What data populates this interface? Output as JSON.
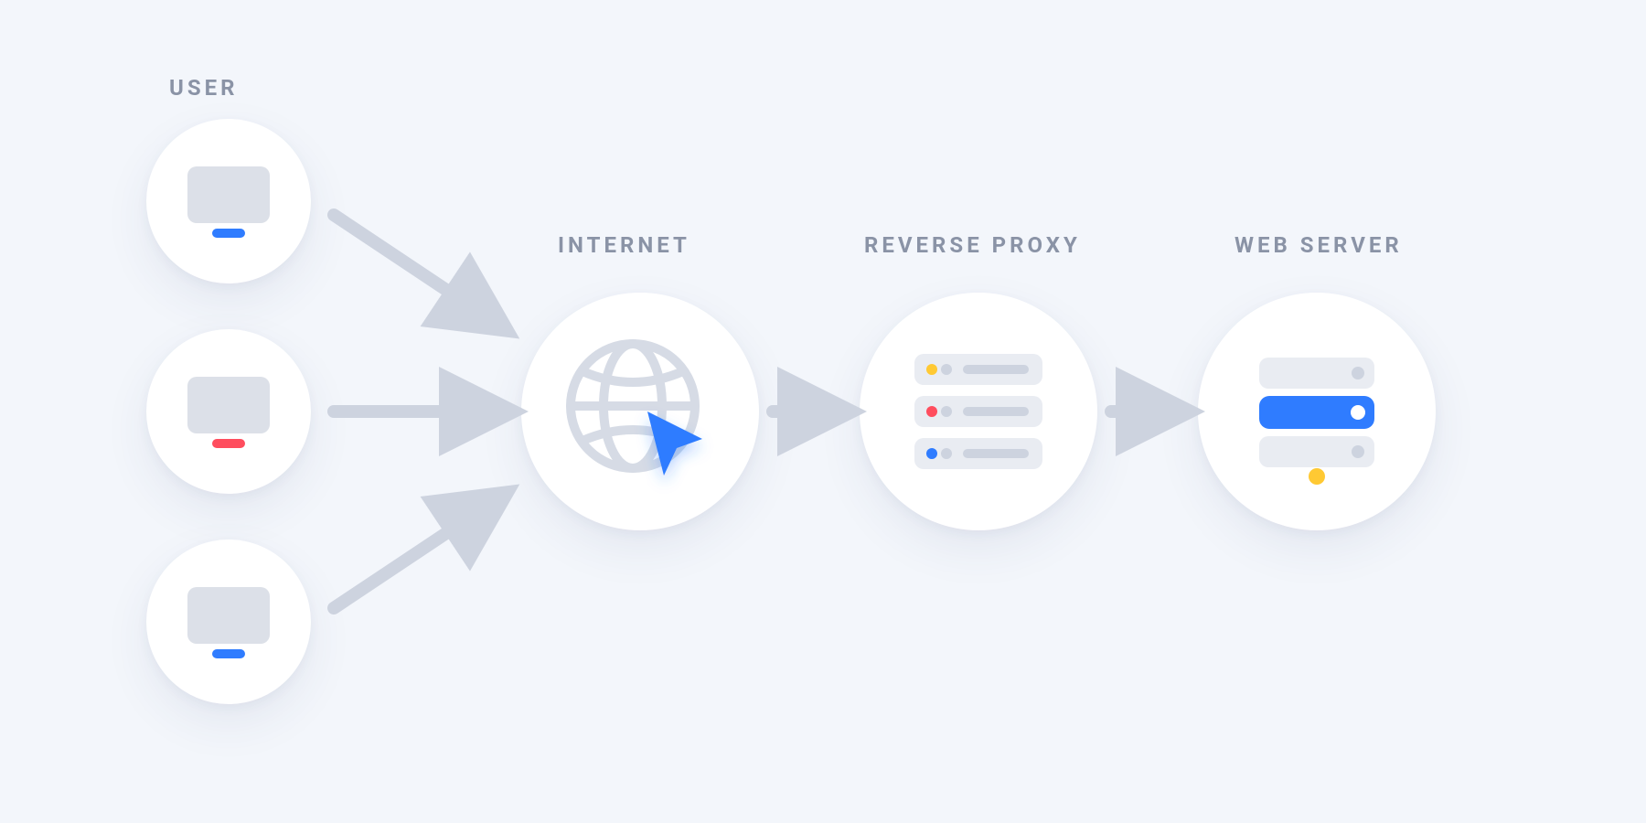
{
  "labels": {
    "user": "USER",
    "internet": "INTERNET",
    "reverse_proxy": "REVERSE PROXY",
    "web_server": "WEB SERVER"
  },
  "colors": {
    "background": "#f3f6fb",
    "circle": "#ffffff",
    "label_text": "#8a93a6",
    "arrow": "#cdd3df",
    "icon_grey_fill": "#dce0e8",
    "icon_grey_stroke": "#cdd3df",
    "blue": "#2f7cff",
    "red": "#ff4d5e",
    "yellow": "#ffc933"
  },
  "nodes": {
    "users": [
      {
        "stand_color": "blue"
      },
      {
        "stand_color": "red"
      },
      {
        "stand_color": "blue"
      }
    ],
    "internet": {
      "icon": "globe-cursor"
    },
    "reverse_proxy": {
      "icon": "server-stack"
    },
    "web_server": {
      "icon": "server-compact"
    }
  }
}
